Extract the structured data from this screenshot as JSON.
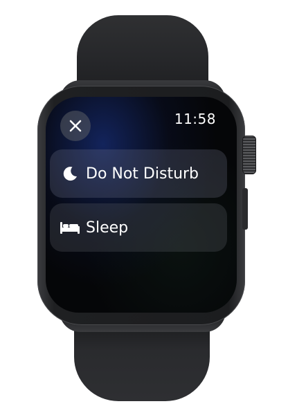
{
  "status": {
    "time": "11:58"
  },
  "controls": {
    "close_icon": "close-icon"
  },
  "focus_modes": [
    {
      "label": "Do Not Disturb",
      "icon": "moon-icon"
    },
    {
      "label": "Sleep",
      "icon": "bed-icon"
    }
  ],
  "colors": {
    "screen_background": "#050608",
    "accent_glow": "#1e3ca0",
    "text": "#ffffff"
  }
}
